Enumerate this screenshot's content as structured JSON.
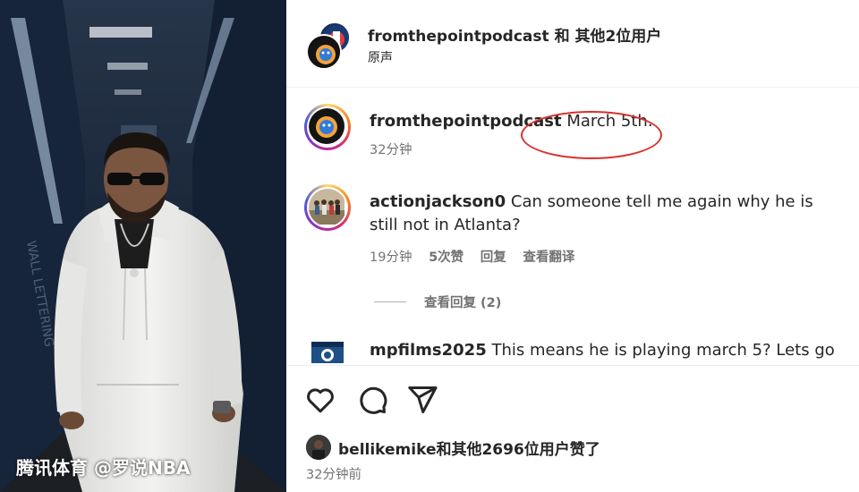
{
  "watermark": "腾讯体育 @罗说NBA",
  "header": {
    "title": "fromthepointpodcast 和 其他2位用户",
    "subtitle": "原声"
  },
  "comments": [
    {
      "username": "fromthepointpodcast",
      "text": "March 5th.",
      "time": "32分钟"
    },
    {
      "username": "actionjackson0",
      "text": "Can someone tell me again why he is still not in Atlanta?",
      "time": "19分钟",
      "likes": "5次赞",
      "reply": "回复",
      "translate": "查看翻译",
      "view_replies": "查看回复 (2)"
    },
    {
      "username": "mpfilms2025",
      "text": "This means he is playing march 5? Lets go"
    }
  ],
  "actions": {
    "like_icon": "heart-icon",
    "comment_icon": "comment-icon",
    "share_icon": "share-icon",
    "liked_by": "bellikemike和其他2696位用户赞了",
    "time_ago": "32分钟前"
  },
  "colors": {
    "annotation_circle": "#d8302f",
    "meta_text": "#737373"
  }
}
